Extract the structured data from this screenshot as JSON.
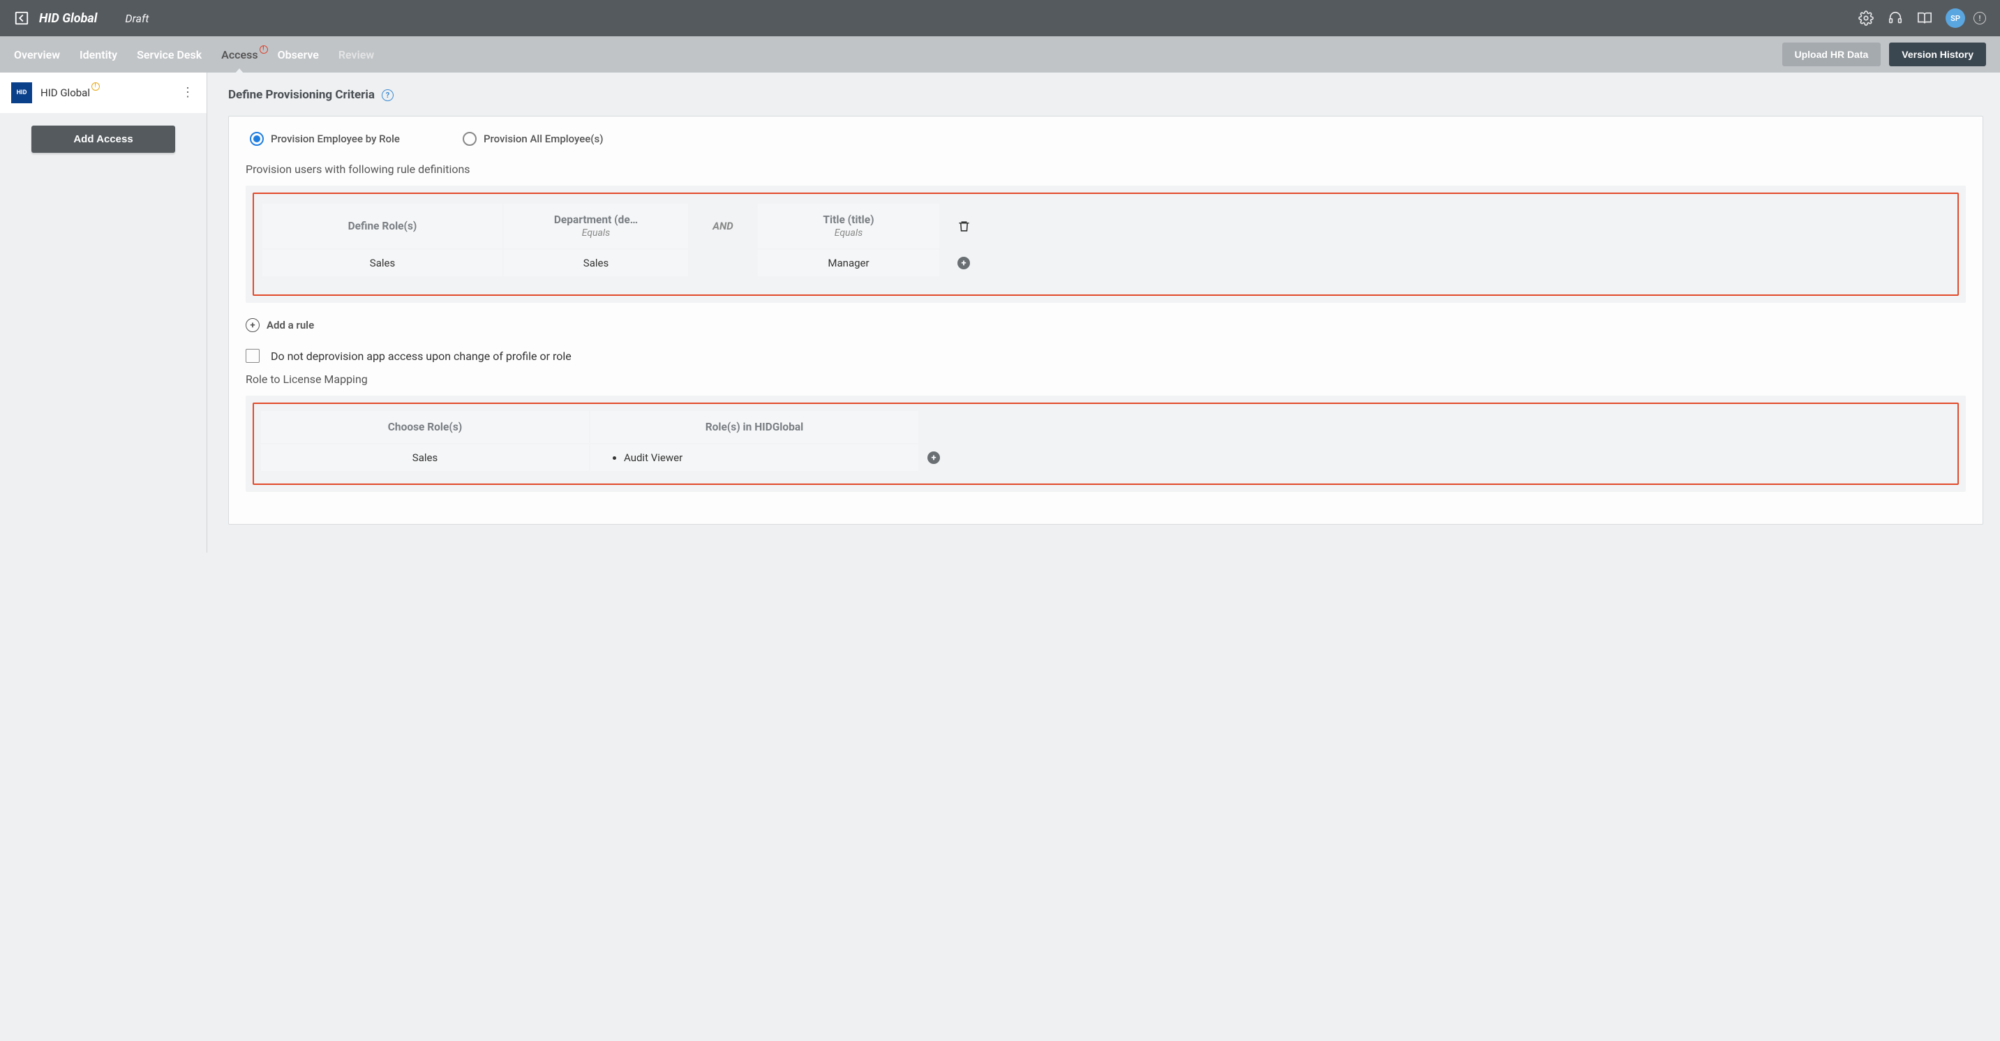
{
  "header": {
    "title": "HID Global",
    "status": "Draft",
    "avatar_initials": "SP"
  },
  "tabs": {
    "items": [
      "Overview",
      "Identity",
      "Service Desk",
      "Access",
      "Observe",
      "Review"
    ],
    "active": "Access",
    "upload_btn": "Upload HR Data",
    "history_btn": "Version History"
  },
  "sidebar": {
    "app_name": "HID Global",
    "app_logo_text": "HID",
    "add_btn": "Add Access"
  },
  "section": {
    "title": "Define Provisioning Criteria",
    "radio1": "Provision Employee by Role",
    "radio2": "Provision All Employee(s)",
    "subhead": "Provision users with following rule definitions",
    "rule": {
      "define_label": "Define Role(s)",
      "dept_label": "Department (de…",
      "dept_op": "Equals",
      "and": "AND",
      "title_label": "Title (title)",
      "title_op": "Equals",
      "val_role": "Sales",
      "val_dept": "Sales",
      "val_title": "Manager"
    },
    "add_rule": "Add a rule",
    "checkbox_label": "Do not deprovision app access upon change of profile or role",
    "mapping_head": "Role to License Mapping",
    "mapping": {
      "col1": "Choose Role(s)",
      "col2": "Role(s) in HIDGlobal",
      "val_role": "Sales",
      "val_mapped": "Audit Viewer"
    }
  }
}
